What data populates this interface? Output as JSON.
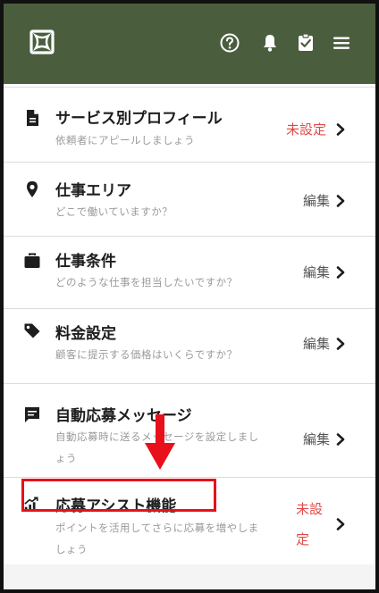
{
  "colors": {
    "header": "#4a5e3e",
    "unset": "#e04848",
    "highlight": "#e8101a"
  },
  "header": {
    "logo_icon": "app-logo-icon",
    "icons": [
      "help-icon",
      "bell-icon",
      "clipboard-check-icon",
      "menu-icon"
    ]
  },
  "rows": [
    {
      "icon": "document-icon",
      "title": "サービス別プロフィール",
      "desc_line1": "依頼者にアピールしましょう",
      "desc_line2": "",
      "status": "未設定",
      "status_type": "unset"
    },
    {
      "icon": "location-pin-icon",
      "title": "仕事エリア",
      "desc_line1": "どこで働いていますか？",
      "desc_line2": "",
      "status": "編集",
      "status_type": "edit"
    },
    {
      "icon": "briefcase-icon",
      "title": "仕事条件",
      "desc_line1": "どのような仕事を担当したいですか？",
      "desc_line2": "",
      "status": "編集",
      "status_type": "edit"
    },
    {
      "icon": "price-tag-icon",
      "title": "料金設定",
      "desc_line1": "顧客に提示する価格はいくらですか？",
      "desc_line2": "",
      "status": "編集",
      "status_type": "edit"
    },
    {
      "icon": "message-icon",
      "title": "自動応募メッセージ",
      "desc_line1": "自動応募時に送るメッセージを設定しまし",
      "desc_line2": "ょう",
      "status": "編集",
      "status_type": "edit"
    },
    {
      "icon": "chart-up-icon",
      "title": "応募アシスト機能",
      "desc_line1": "ポイントを活用してさらに応募を増やしま",
      "desc_line2": "しょう",
      "status_line1": "未設",
      "status_line2": "定",
      "status_type": "unset"
    }
  ]
}
